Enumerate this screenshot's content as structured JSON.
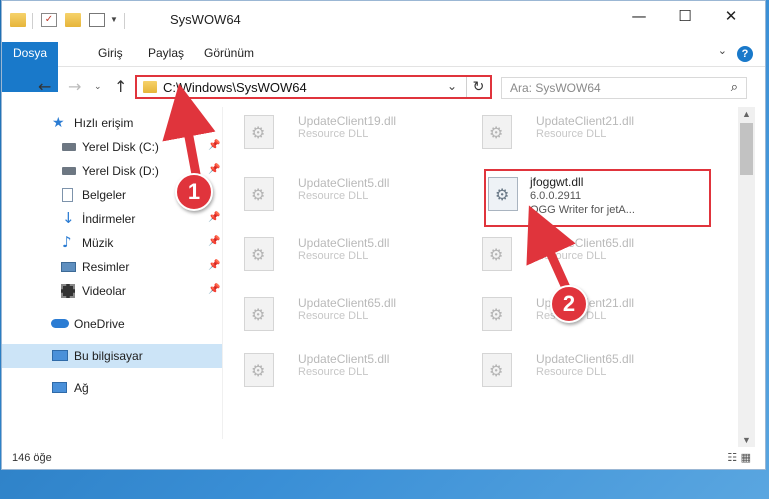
{
  "window": {
    "title": "SysWOW64",
    "controls": {
      "minimize": "—",
      "maximize": "☐",
      "close": "✕"
    }
  },
  "ribbon": {
    "tabs": [
      "Dosya",
      "Giriş",
      "Paylaş",
      "Görünüm"
    ],
    "help": "?"
  },
  "nav": {
    "address": "C:\\Windows\\SysWOW64",
    "search_placeholder": "Ara: SysWOW64"
  },
  "sidebar": {
    "items": [
      {
        "label": "Hızlı erişim",
        "icon": "star-icon"
      },
      {
        "label": "Yerel Disk (C:)",
        "icon": "drive-icon"
      },
      {
        "label": "Yerel Disk (D:)",
        "icon": "drive-icon"
      },
      {
        "label": "Belgeler",
        "icon": "documents-icon"
      },
      {
        "label": "İndirmeler",
        "icon": "download-icon"
      },
      {
        "label": "Müzik",
        "icon": "music-icon"
      },
      {
        "label": "Resimler",
        "icon": "pictures-icon"
      },
      {
        "label": "Videolar",
        "icon": "video-icon"
      },
      {
        "label": "OneDrive",
        "icon": "cloud-icon"
      },
      {
        "label": "Bu bilgisayar",
        "icon": "computer-icon"
      },
      {
        "label": "Ağ",
        "icon": "network-icon"
      }
    ]
  },
  "files": [
    {
      "name": "UpdateClient19.dll",
      "desc": "Resource DLL"
    },
    {
      "name": "UpdateClient21.dll",
      "desc": "Resource DLL"
    },
    {
      "name": "UpdateClient5.dll",
      "desc": "Resource DLL"
    },
    {
      "name": "jfoggwt.dll",
      "version": "6.0.0.2911",
      "desc": "OGG Writer for jetA..."
    },
    {
      "name": "UpdateClient5.dll",
      "desc": "Resource DLL"
    },
    {
      "name": "UpdateClient65.dll",
      "desc": "Resource DLL"
    },
    {
      "name": "UpdateClient65.dll",
      "desc": "Resource DLL"
    },
    {
      "name": "UpdateClient21.dll",
      "desc": "Resource DLL"
    },
    {
      "name": "UpdateClient5.dll",
      "desc": "Resource DLL"
    },
    {
      "name": "UpdateClient65.dll",
      "desc": "Resource DLL"
    }
  ],
  "status": {
    "count": "146 öğe"
  },
  "callouts": [
    "1",
    "2"
  ],
  "colors": {
    "accent": "#1979ca",
    "highlight": "#e0343c",
    "selection": "#cce4f7"
  }
}
